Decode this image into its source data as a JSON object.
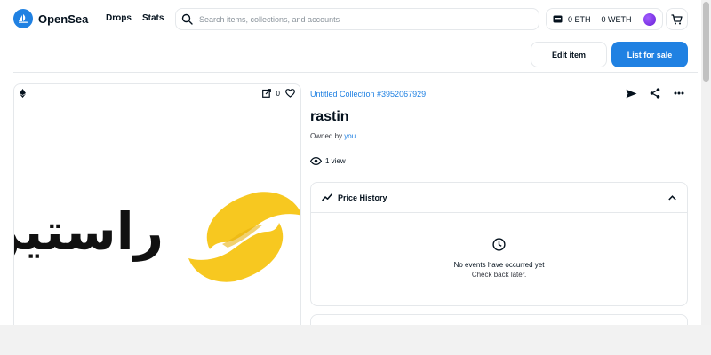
{
  "nav": {
    "brand": "OpenSea",
    "links": [
      "Drops",
      "Stats"
    ],
    "search_placeholder": "Search items, collections, and accounts",
    "eth_balance": "0 ETH",
    "weth_balance": "0 WETH"
  },
  "actions": {
    "edit_label": "Edit item",
    "list_label": "List for sale"
  },
  "item": {
    "collection": "Untitled Collection #3952067929",
    "title": "rastin",
    "owned_prefix": "Owned by",
    "owner": "you",
    "views": "1 view",
    "favorites": "0",
    "artwork_text": "راستین"
  },
  "price_history": {
    "title": "Price History",
    "empty_title": "No events have occurred yet",
    "empty_sub": "Check back later."
  },
  "colors": {
    "accent": "#2081e2",
    "logo_yellow": "#f7c820",
    "text": "#04111d",
    "border": "#e5e8eb"
  }
}
